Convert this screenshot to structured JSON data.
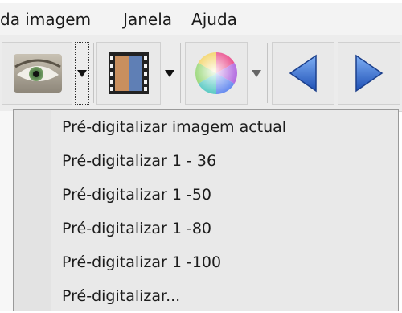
{
  "menubar": {
    "items": [
      "da imagem",
      "Janela",
      "Ajuda"
    ]
  },
  "toolbar": {
    "buttons": [
      {
        "icon": "eye-preview-icon",
        "has_dropdown": true
      },
      {
        "icon": "film-strip-icon",
        "has_dropdown": true
      },
      {
        "icon": "color-wheel-icon",
        "has_dropdown": true
      },
      {
        "icon": "arrow-left-icon",
        "has_dropdown": false
      },
      {
        "icon": "arrow-right-icon",
        "has_dropdown": false
      }
    ]
  },
  "dropdown": {
    "items": [
      "Pré-digitalizar imagem actual",
      "Pré-digitalizar 1 - 36",
      "Pré-digitalizar 1 -50",
      "Pré-digitalizar 1 -80",
      "Pré-digitalizar 1 -100",
      "Pré-digitalizar..."
    ]
  },
  "colors": {
    "menu_bg": "#e9e9e9",
    "toolbar_bg": "#ececec",
    "arrow_blue": "#2a63c8"
  }
}
